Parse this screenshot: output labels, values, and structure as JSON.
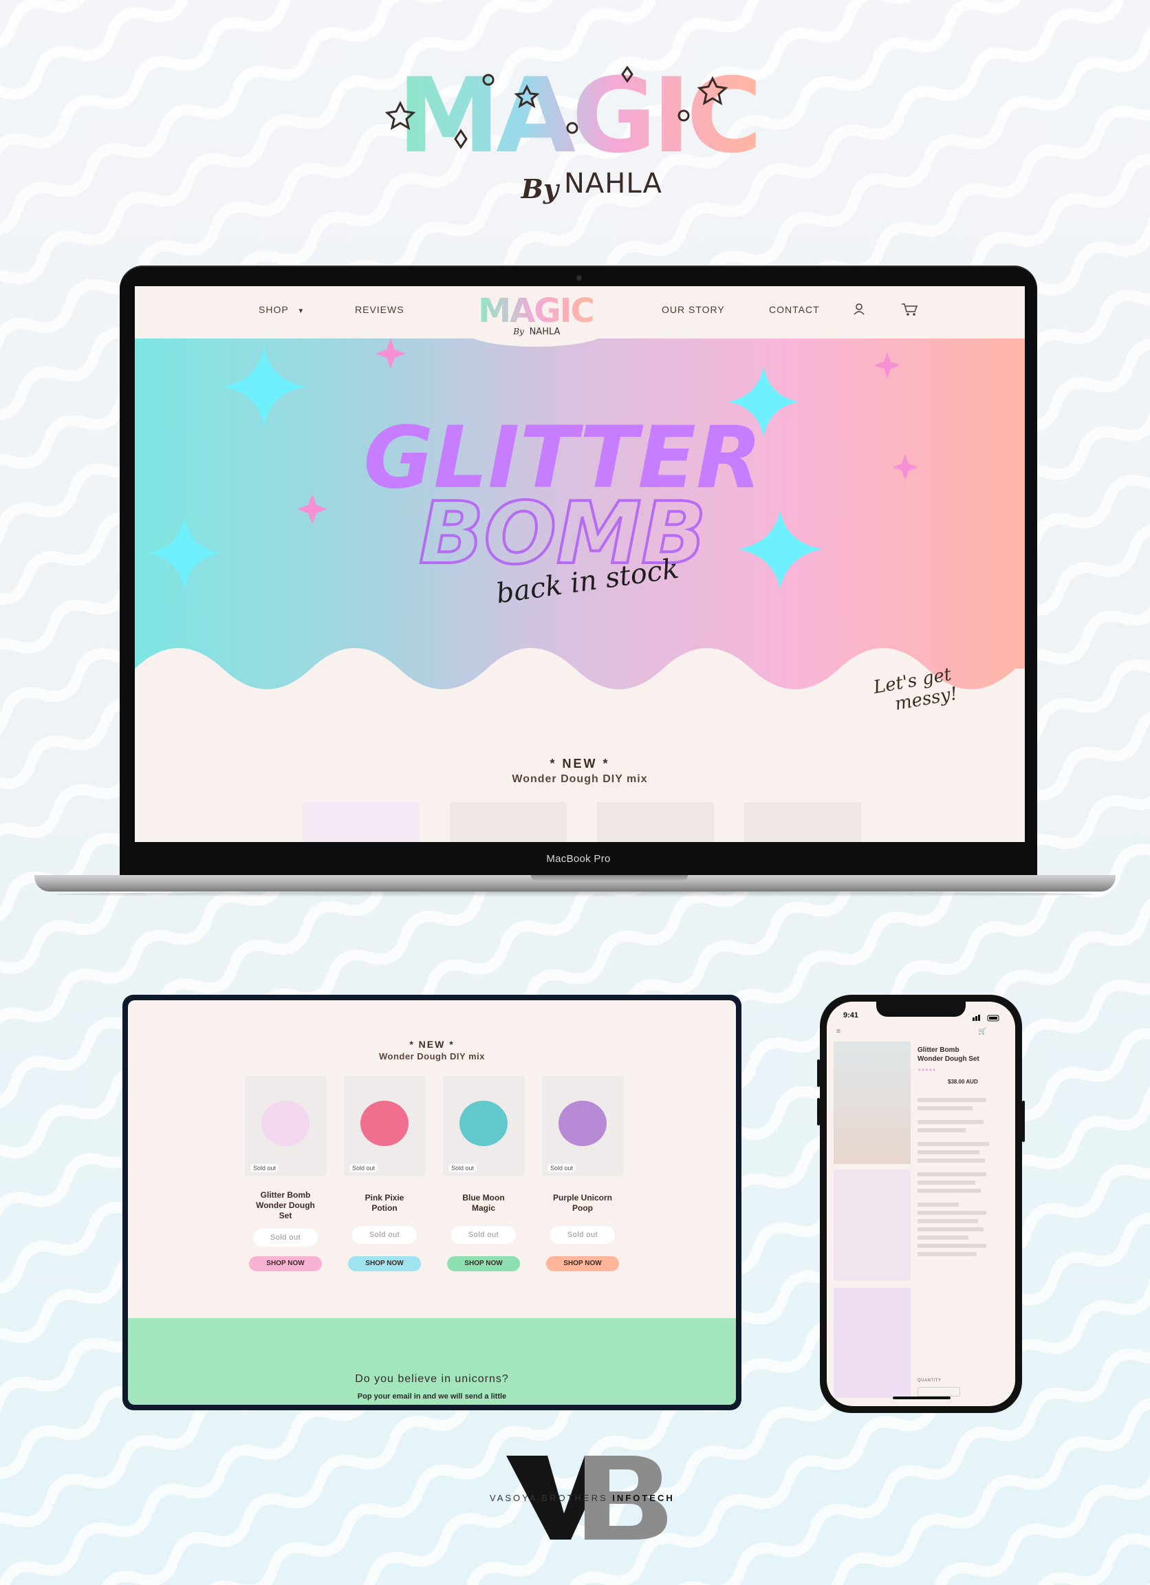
{
  "brand": {
    "logo_word": "MAGIC",
    "logo_by": "By",
    "logo_name": "NAHLA"
  },
  "laptop": {
    "device_label": "MacBook Pro",
    "nav": {
      "shop": "SHOP",
      "reviews": "REVIEWS",
      "our_story": "OUR STORY",
      "contact": "CONTACT",
      "logo_word": "MAGIC",
      "logo_by": "By",
      "logo_name": "NAHLA"
    },
    "hero": {
      "line1": "GLITTER",
      "line2": "BOMB",
      "script": "back in stock",
      "corner_script_1": "Let's get",
      "corner_script_2": "messy!"
    },
    "new_section": {
      "title": "* NEW *",
      "subtitle": "Wonder Dough DIY mix"
    }
  },
  "tablet": {
    "new_section": {
      "title": "* NEW *",
      "subtitle": "Wonder Dough DIY mix"
    },
    "products": [
      {
        "name_lines": [
          "Glitter Bomb",
          "Wonder Dough",
          "Set"
        ],
        "badge": "Sold out",
        "sold_label": "Sold out",
        "shop_label": "SHOP NOW",
        "btn_color": "#f8b3d4"
      },
      {
        "name_lines": [
          "Pink Pixie",
          "Potion"
        ],
        "badge": "Sold out",
        "sold_label": "Sold out",
        "shop_label": "SHOP NOW",
        "btn_color": "#9fe3ee"
      },
      {
        "name_lines": [
          "Blue Moon",
          "Magic"
        ],
        "badge": "Sold out",
        "sold_label": "Sold out",
        "shop_label": "SHOP NOW",
        "btn_color": "#8fe0b0"
      },
      {
        "name_lines": [
          "Purple Unicorn",
          "Poop"
        ],
        "badge": "Sold out",
        "sold_label": "Sold out",
        "shop_label": "SHOP NOW",
        "btn_color": "#ffb59a"
      }
    ],
    "newsletter": {
      "title": "Do you believe in unicorns?",
      "subtitle": "Pop your email in and we will send a little"
    }
  },
  "phone": {
    "time": "9:41",
    "product_title_line1": "Glitter Bomb",
    "product_title_line2": "Wonder Dough Set",
    "price": "$38.00 AUD",
    "quantity_label": "QUANTITY"
  },
  "footer_logo": {
    "letters": "VB",
    "text_light": "VASOYA BROTHERS ",
    "text_bold": "INFOTECH"
  },
  "colors": {
    "mint": "#8fe6c8",
    "aqua": "#7ee6e2",
    "pink": "#f8b6d8",
    "peach": "#ffb6a8",
    "purple": "#c77dff",
    "cyan_star": "#6ff0ff",
    "brown_text": "#3d2a27",
    "newsletter_green": "#a4e6bb"
  }
}
